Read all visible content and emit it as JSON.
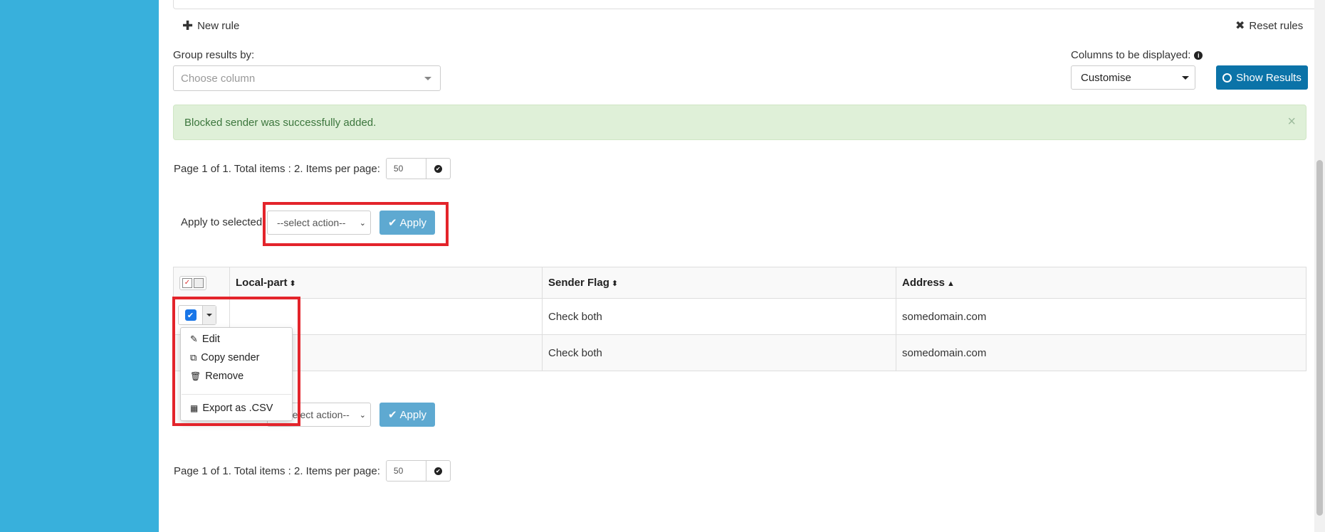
{
  "toolbar": {
    "new_rule": "New rule",
    "reset_rules": "Reset rules"
  },
  "group": {
    "label": "Group results by:",
    "placeholder": "Choose column"
  },
  "columns": {
    "label": "Columns to be displayed:",
    "value": "Customise"
  },
  "show_results": "Show Results",
  "alert": {
    "message": "Blocked sender was successfully added.",
    "close": "×"
  },
  "pager": {
    "text": "Page 1 of 1. Total items : 2. Items per page:",
    "per_page": "50"
  },
  "bulk": {
    "label": "Apply to selected:",
    "select": "--select action--",
    "apply": "Apply"
  },
  "table": {
    "headers": [
      "Local-part",
      "Sender Flag",
      "Address"
    ],
    "rows": [
      {
        "local": "",
        "flag": "Check both",
        "address": "somedomain.com"
      },
      {
        "local": "",
        "flag": "Check both",
        "address": "somedomain.com"
      }
    ]
  },
  "row_menu": {
    "edit": "Edit",
    "copy": "Copy sender",
    "remove": "Remove",
    "export": "Export as .CSV"
  },
  "bottom_bulk": {
    "select": "elect action--",
    "apply": "Apply"
  },
  "colors": {
    "sidebar": "#38b0dc",
    "primary": "#0b73a8",
    "apply": "#5ea9d1",
    "alert_bg": "#dff0d8",
    "highlight": "#e3242b"
  }
}
